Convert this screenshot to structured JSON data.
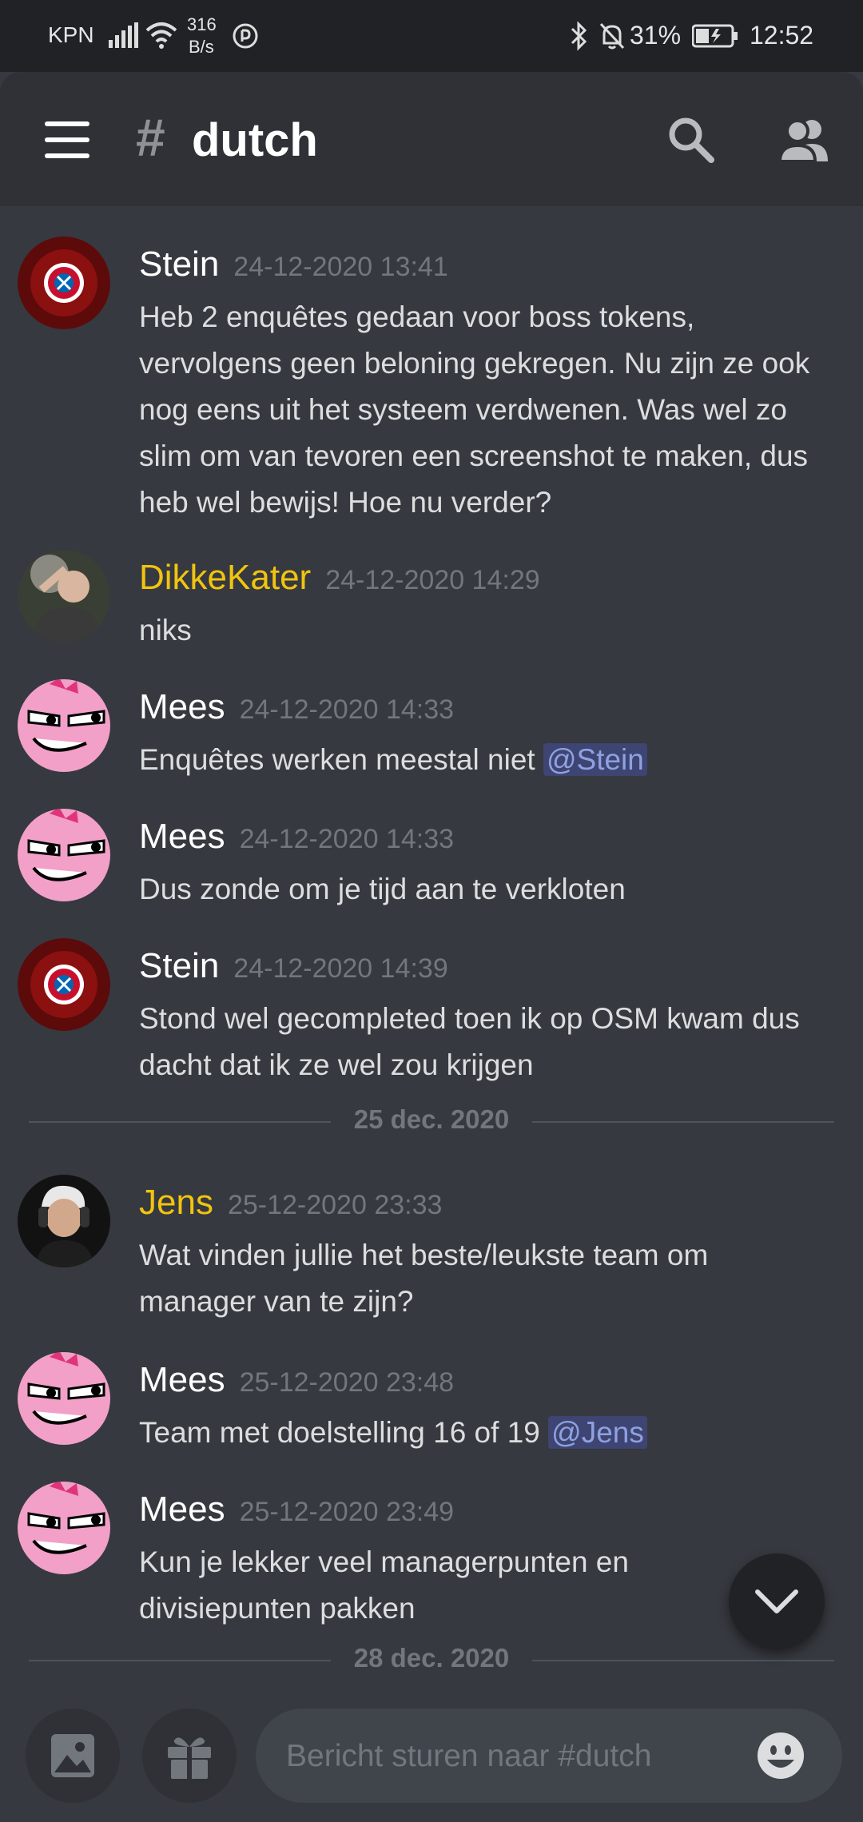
{
  "status_bar": {
    "carrier": "KPN",
    "speed_value": "316",
    "speed_unit": "B/s",
    "battery": "31%",
    "time": "12:52"
  },
  "header": {
    "hash": "#",
    "channel": "dutch"
  },
  "messages": [
    {
      "author": "Stein",
      "author_color": "#ffffff",
      "timestamp": "24-12-2020 13:41",
      "lines": [
        "Heb 2 enquêtes gedaan voor boss tokens,",
        "vervolgens geen beloning gekregen. Nu zijn ze ook",
        "nog eens uit het systeem verdwenen. Was wel zo",
        "slim om van tevoren een screenshot te maken, dus",
        "heb wel bewijs! Hoe nu verder?"
      ]
    },
    {
      "author": "DikkeKater",
      "author_color": "#f1c40f",
      "timestamp": "24-12-2020 14:29",
      "lines": [
        "niks"
      ]
    },
    {
      "author": "Mees",
      "author_color": "#ffffff",
      "timestamp": "24-12-2020 14:33",
      "text": "Enquêtes werken meestal niet ",
      "mention": "@Stein"
    },
    {
      "author": "Mees",
      "author_color": "#ffffff",
      "timestamp": "24-12-2020 14:33",
      "lines": [
        "Dus zonde om je tijd aan te verkloten"
      ]
    },
    {
      "author": "Stein",
      "author_color": "#ffffff",
      "timestamp": "24-12-2020 14:39",
      "lines": [
        "Stond wel gecompleted toen ik op OSM kwam dus",
        "dacht dat ik ze wel zou krijgen"
      ]
    },
    {
      "author": "Jens",
      "author_color": "#f1c40f",
      "timestamp": "25-12-2020 23:33",
      "lines": [
        "Wat vinden jullie het beste/leukste team om",
        "manager van te zijn?"
      ]
    },
    {
      "author": "Mees",
      "author_color": "#ffffff",
      "timestamp": "25-12-2020 23:48",
      "text": "Team met doelstelling 16 of 19 ",
      "mention": "@Jens"
    },
    {
      "author": "Mees",
      "author_color": "#ffffff",
      "timestamp": "25-12-2020 23:49",
      "lines": [
        "Kun je lekker veel managerpunten en",
        "divisiepunten pakken"
      ]
    }
  ],
  "dividers": [
    "25 dec. 2020",
    "28 dec. 2020"
  ],
  "composer": {
    "placeholder": "Bericht sturen naar #dutch"
  },
  "icons": {
    "menu": "hamburger-menu-icon",
    "search": "search-icon",
    "members": "members-icon",
    "image": "image-icon",
    "gift": "gift-icon",
    "emoji": "emoji-icon",
    "scroll_down": "chevron-down-icon"
  },
  "colors": {
    "background": "#36393f",
    "header": "#2f3136",
    "mention_bg": "#3e4572",
    "mention_fg": "#8ea1e1",
    "highlight_name": "#f1c40f"
  }
}
